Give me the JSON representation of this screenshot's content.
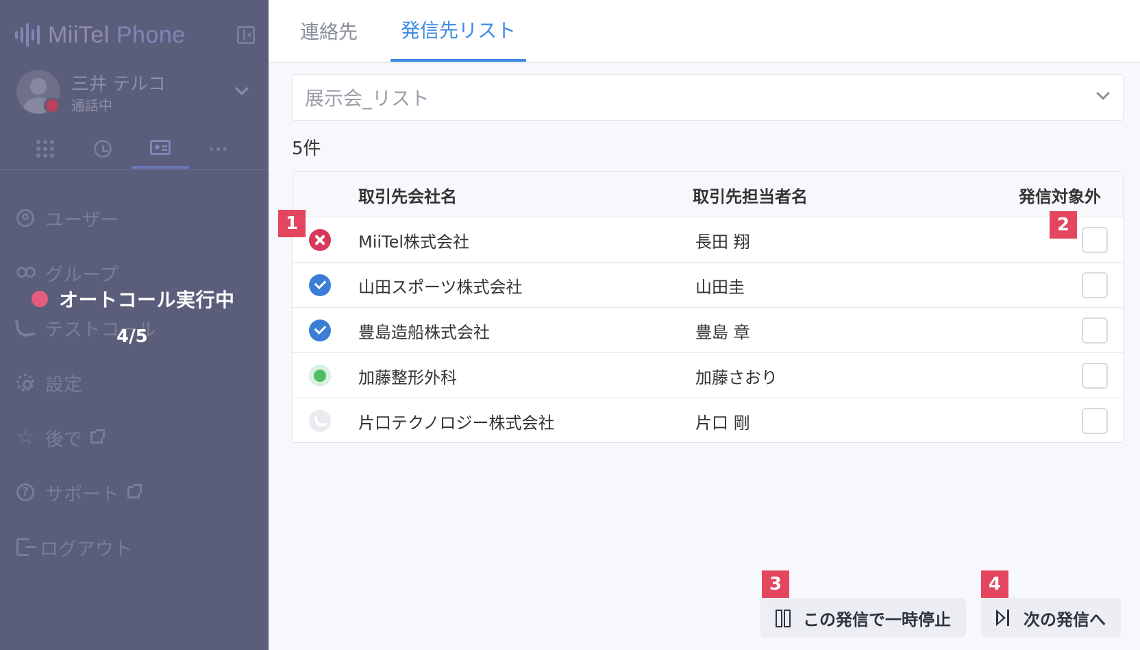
{
  "sidebar": {
    "logo": {
      "miitel": "MiiTel",
      "phone": "Phone"
    },
    "user": {
      "name": "三井 テルコ",
      "status": "通話中"
    },
    "nav": [
      {
        "label": "ユーザー",
        "icon": "user-circle-icon"
      },
      {
        "label": "グループ",
        "icon": "group-icon"
      },
      {
        "label": "テストコール",
        "icon": "phone-icon"
      },
      {
        "label": "設定",
        "icon": "gear-icon"
      },
      {
        "label": "後で",
        "icon": "star-icon",
        "external": true
      },
      {
        "label": "サポート",
        "icon": "help-icon",
        "external": true
      },
      {
        "label": "ログアウト",
        "icon": "logout-icon"
      }
    ],
    "autocall": {
      "label": "オートコール実行中",
      "progress": "4/5"
    }
  },
  "main": {
    "tabs": [
      {
        "label": "連絡先",
        "active": false
      },
      {
        "label": "発信先リスト",
        "active": true
      }
    ],
    "list_select": {
      "value": "展示会_リスト"
    },
    "count": "5件",
    "table": {
      "headers": {
        "company": "取引先会社名",
        "contact": "取引先担当者名",
        "exclude": "発信対象外"
      },
      "rows": [
        {
          "status": "error",
          "company": "MiiTel株式会社",
          "contact": "長田 翔",
          "excluded": false
        },
        {
          "status": "done",
          "company": "山田スポーツ株式会社",
          "contact": "山田圭",
          "excluded": false
        },
        {
          "status": "done",
          "company": "豊島造船株式会社",
          "contact": "豊島 章",
          "excluded": false
        },
        {
          "status": "active",
          "company": "加藤整形外科",
          "contact": "加藤さおり",
          "excluded": false
        },
        {
          "status": "pending",
          "company": "片口テクノロジー株式会社",
          "contact": "片口 剛",
          "excluded": false
        }
      ]
    },
    "buttons": {
      "pause": "この発信で一時停止",
      "next": "次の発信へ"
    }
  },
  "badges": [
    "1",
    "2",
    "3",
    "4"
  ],
  "colors": {
    "accent": "#3b8ae3",
    "badge": "#e4465f",
    "sidebar": "#5b5e7a",
    "error": "#d6385a",
    "done": "#3a7fd5",
    "active": "#4dbe62"
  }
}
